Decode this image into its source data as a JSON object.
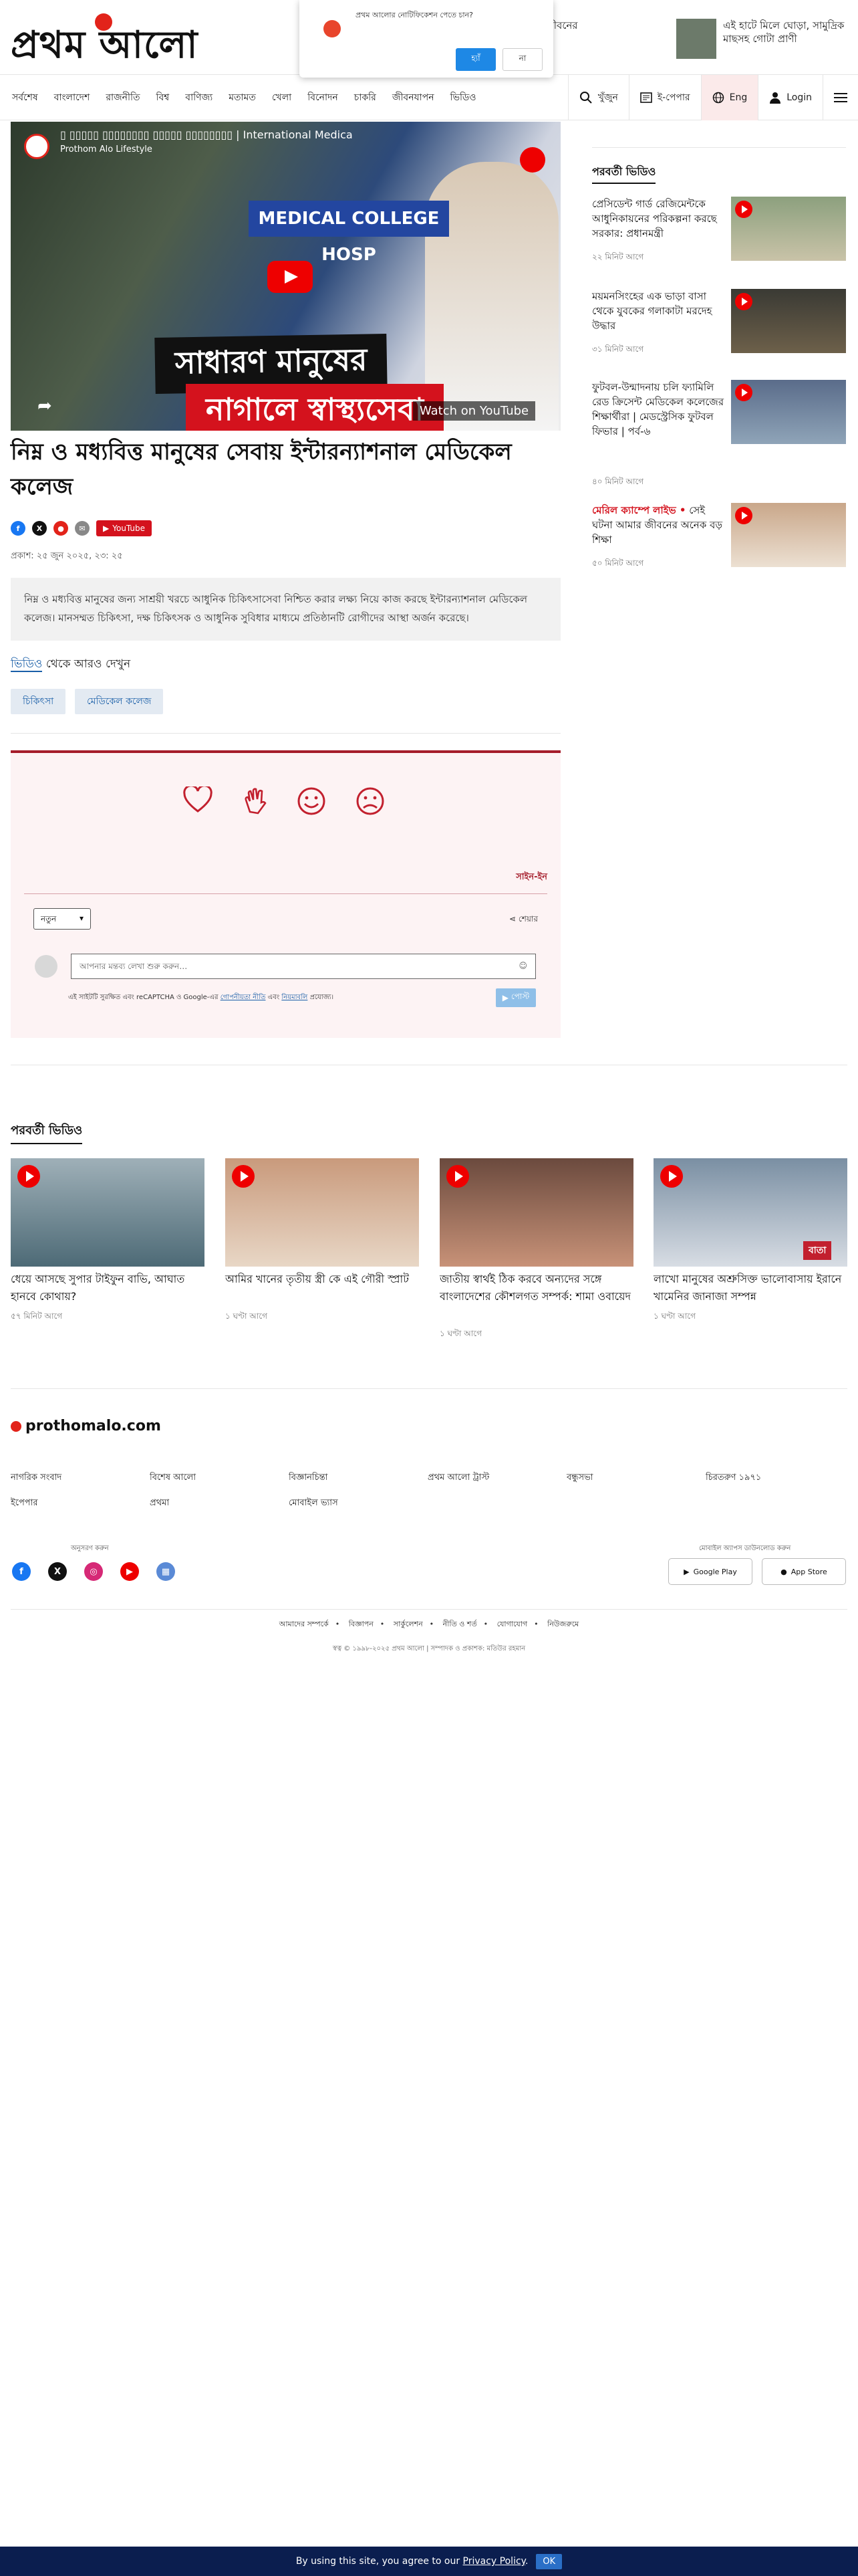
{
  "header": {
    "logo_text": "প্রথম আলো",
    "teasers": [
      {
        "text": "সেই ঘটনা আমার জীবনের অনেক বড় শিক্ষা"
      },
      {
        "text": "এই হাটে মিলে ঘোড়া, সামুদ্রিক মাছসহ গোটা প্রাণী"
      }
    ],
    "notification": {
      "question": "প্রথম আলোর নোটিফিকেশন পেতে চান?",
      "yes": "হ্যাঁ",
      "no": "না"
    }
  },
  "nav": {
    "items": [
      "সর্বশেষ",
      "বাংলাদেশ",
      "রাজনীতি",
      "বিশ্ব",
      "বাণিজ্য",
      "মতামত",
      "খেলা",
      "বিনোদন",
      "চাকরি",
      "জীবনযাপন",
      "ভিডিও"
    ],
    "search": "খুঁজুন",
    "epaper": "ই-পেপার",
    "lang": "Eng",
    "login": "Login"
  },
  "video": {
    "channel": "Prothom Alo Lifestyle",
    "title": "| International Medica",
    "sign_text": "MEDICAL COLLEGE HOSP",
    "caption_line1": "সাধারণ মানুষের",
    "caption_line2": "নাগালে স্বাস্থ্যসেবা",
    "watch_on": "Watch on YouTube"
  },
  "article": {
    "headline": "নিম্ন ও মধ্যবিত্ত মানুষের সেবায় ইন্টারন্যাশনাল মেডিকেল কলেজ",
    "published": "প্রকাশ: ২৫ জুন ২০২৫, ২৩: ২৫",
    "youtube_label": "YouTube",
    "summary": "নিম্ন ও মধ্যবিত্ত মানুষের জন্য সাশ্রয়ী খরচে আধুনিক চিকিৎসাসেবা নিশ্চিত করার লক্ষ্য নিয়ে কাজ করছে ইন্টারন্যাশনাল মেডিকেল কলেজ। মানসম্মত চিকিৎসা, দক্ষ চিকিৎসক ও আধুনিক সুবিধার মাধ্যমে প্রতিষ্ঠানটি রোগীদের আস্থা অর্জন করেছে।",
    "more_section": "ভিডিও",
    "more_suffix": " থেকে আরও দেখুন",
    "tags": [
      "চিকিৎসা",
      "মেডিকেল কলেজ"
    ]
  },
  "comments": {
    "sign_in": "সাইন-ইন",
    "sort_label": "নতুন",
    "share_label": "শেয়ার",
    "input_placeholder": "আপনার মন্তব্য লেখা শুরু করুন…",
    "recaptcha_pre": "এই সাইটটি সুরক্ষিত এবং reCAPTCHA ও Google-এর ",
    "privacy": "গোপনীয়তা নীতি",
    "and": " এবং ",
    "terms": "নিয়মাবলি",
    "recaptcha_post": " প্রযোজ্য।",
    "send": "পোস্ট"
  },
  "rail": {
    "title": "পরবর্তী ভিডিও",
    "items": [
      {
        "title": "প্রেসিডেন্ট গার্ড রেজিমেন্টকে আধুনিকায়নের পরিকল্পনা করছে সরকার: প্রধানমন্ত্রী",
        "meta": "২২ মিনিট আগে"
      },
      {
        "title": "ময়মনসিংহের এক ভাড়া বাসা থেকে যুবকের গলাকাটা মরদেহ উদ্ধার",
        "meta": "৩১ মিনিট আগে"
      },
      {
        "title": "ফুটবল-উন্মাদনায় চলি ফ্যামিলি রেড ক্রিসেন্ট মেডিকেল কলেজের শিক্ষার্থীরা | মেডস্ট্রেসিক ফুটবল ফিভার | পর্ব-৬",
        "meta": "৪০ মিনিট আগে"
      },
      {
        "title_prefix": "মেরিল ক্যাম্পে লাইভ •",
        "title": " সেই ঘটনা আমার জীবনের অনেক বড় শিক্ষা",
        "meta": "৫০ মিনিট আগে"
      }
    ]
  },
  "next_videos": {
    "title": "পরবর্তী ভিডিও",
    "items": [
      {
        "title": "ধেয়ে আসছে সুপার টাইফুন বাভি, আঘাত হানবে কোথায়?",
        "meta": "৫৭ মিনিট আগে"
      },
      {
        "title": "আমির খানের তৃতীয় স্ত্রী কে এই গৌরী স্প্রাট",
        "meta": "১ ঘণ্টা আগে"
      },
      {
        "title": "জাতীয় স্বার্থই ঠিক করবে অন্যদের সঙ্গে বাংলাদেশের কৌশলগত সম্পর্ক: শামা ওবায়েদ",
        "meta": "১ ঘণ্টা আগে"
      },
      {
        "title": "লাখো মানুষের অশ্রুসিক্ত ভালোবাসায় ইরানে খামেনির জানাজা সম্পন্ন",
        "meta": "১ ঘণ্টা আগে"
      }
    ],
    "badge_text": "বাতা"
  },
  "footer": {
    "logo": "prothomalo.com",
    "links_row1": [
      "নাগরিক সংবাদ",
      "বিশেষ আলো",
      "বিজ্ঞানচিন্তা",
      "প্রথম আলো ট্রাস্ট",
      "বন্ধুসভা",
      "চিরতরুণ ১৯৭১"
    ],
    "links_row2": [
      "ইপেপার",
      "প্রথমা",
      "মোবাইল ভ্যাস"
    ],
    "follow_label": "অনুসরণ করুন",
    "apps_label": "মোবাইল অ্যাপস ডাউনলোড করুন",
    "google_play": "Google Play",
    "app_store": "App Store",
    "bottom_links": [
      "আমাদের সম্পর্কে",
      "বিজ্ঞাপন",
      "সার্কুলেশন",
      "নীতি ও শর্ত",
      "যোগাযোগ",
      "নিউজরুমে"
    ],
    "copyright": "স্বত্ব © ১৯৯৮-২০২৫ প্রথম আলো  |  সম্পাদক ও প্রকাশক: মতিউর রহমান"
  },
  "cookie": {
    "text": "By using this site, you agree to our ",
    "link": "Privacy Policy",
    "dot": ".",
    "ok": "OK"
  },
  "colors": {
    "brand_red": "#e2231a",
    "link_blue": "#1a5fa8",
    "cookie_bg": "#0b1e4f"
  }
}
